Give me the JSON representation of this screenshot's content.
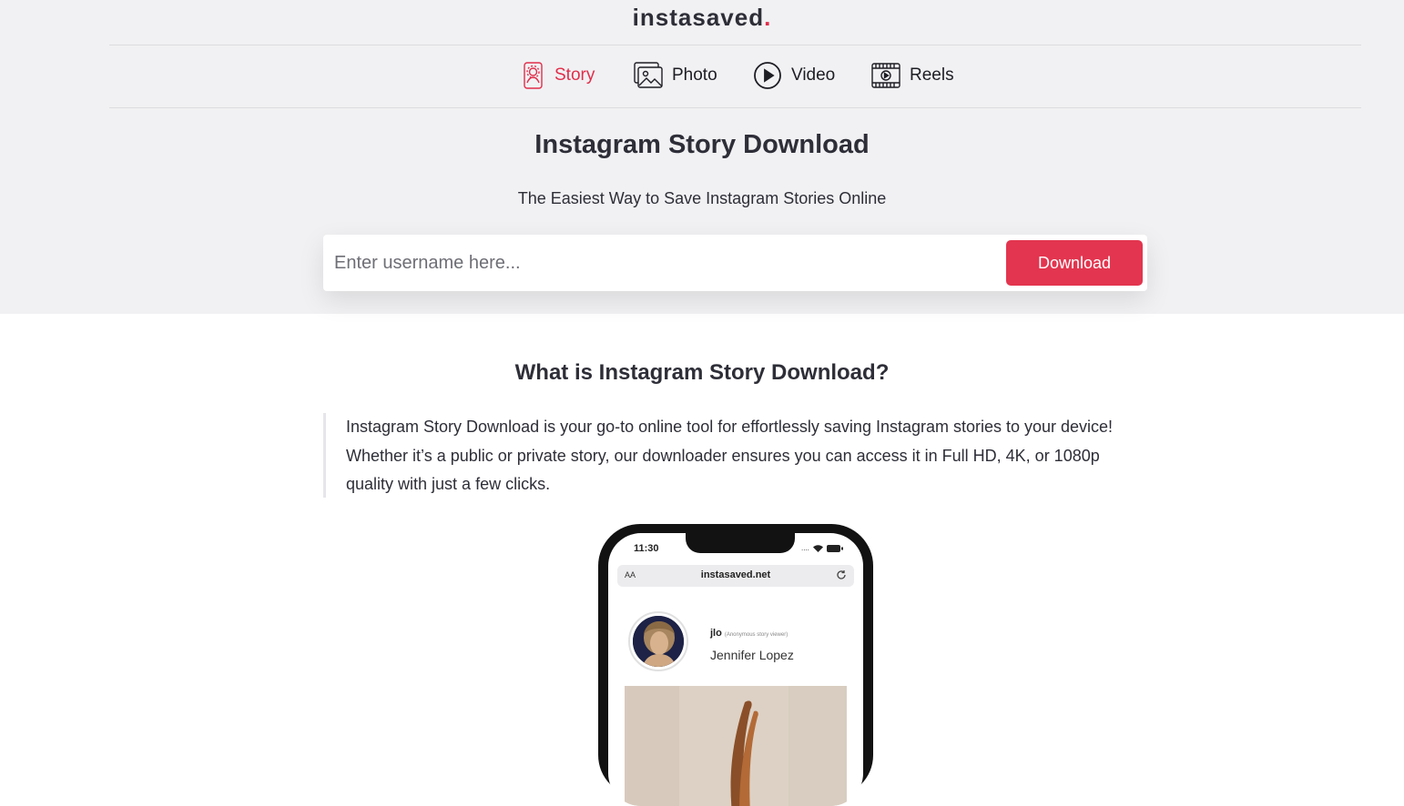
{
  "brand": {
    "name": "instasaved",
    "dot": "."
  },
  "nav": {
    "tabs": [
      {
        "label": "Story",
        "icon": "story-icon",
        "active": true
      },
      {
        "label": "Photo",
        "icon": "photo-icon",
        "active": false
      },
      {
        "label": "Video",
        "icon": "video-icon",
        "active": false
      },
      {
        "label": "Reels",
        "icon": "reels-icon",
        "active": false
      }
    ]
  },
  "hero": {
    "title": "Instagram Story Download",
    "subtitle": "The Easiest Way to Save Instagram Stories Online",
    "input_placeholder": "Enter username here...",
    "button_label": "Download"
  },
  "about": {
    "title": "What is Instagram Story Download?",
    "text": "Instagram Story Download is your go-to online tool for effortlessly saving Instagram stories to your device! Whether it’s a public or private story, our downloader ensures you can access it in Full HD, 4K, or 1080p quality with just a few clicks."
  },
  "phone": {
    "time": "11:30",
    "aa": "AA",
    "url": "instasaved.net",
    "username": "jlo",
    "username_note": "(Anonymous story viewer)",
    "full_name": "Jennifer Lopez"
  },
  "colors": {
    "accent": "#e3354f",
    "header_bg": "#f1f1f3",
    "text": "#2e2e38"
  }
}
